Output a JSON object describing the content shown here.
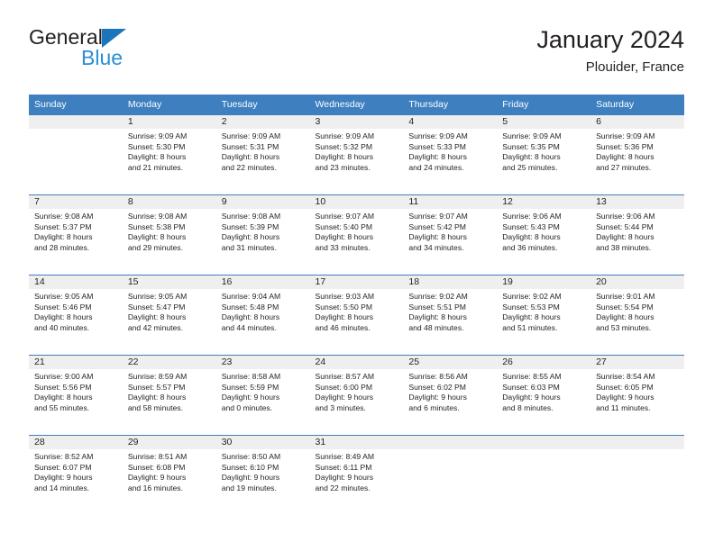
{
  "brand": {
    "name_part1": "General",
    "name_part2": "Blue",
    "triangle_icon": "triangle-logo-icon",
    "color_dark": "#231f20",
    "color_blue": "#2a8fd4"
  },
  "header": {
    "title": "January 2024",
    "subtitle": "Plouider, France"
  },
  "theme": {
    "header_blue": "#3d7fbf",
    "daynum_band": "#efefef",
    "text": "#231f20"
  },
  "calendar": {
    "weekday_headers": [
      "Sunday",
      "Monday",
      "Tuesday",
      "Wednesday",
      "Thursday",
      "Friday",
      "Saturday"
    ],
    "weeks": [
      [
        {
          "day": "",
          "empty": true,
          "sunrise": "",
          "sunset": "",
          "daylight_line1": "",
          "daylight_line2": ""
        },
        {
          "day": "1",
          "empty": false,
          "sunrise": "Sunrise: 9:09 AM",
          "sunset": "Sunset: 5:30 PM",
          "daylight_line1": "Daylight: 8 hours",
          "daylight_line2": "and 21 minutes."
        },
        {
          "day": "2",
          "empty": false,
          "sunrise": "Sunrise: 9:09 AM",
          "sunset": "Sunset: 5:31 PM",
          "daylight_line1": "Daylight: 8 hours",
          "daylight_line2": "and 22 minutes."
        },
        {
          "day": "3",
          "empty": false,
          "sunrise": "Sunrise: 9:09 AM",
          "sunset": "Sunset: 5:32 PM",
          "daylight_line1": "Daylight: 8 hours",
          "daylight_line2": "and 23 minutes."
        },
        {
          "day": "4",
          "empty": false,
          "sunrise": "Sunrise: 9:09 AM",
          "sunset": "Sunset: 5:33 PM",
          "daylight_line1": "Daylight: 8 hours",
          "daylight_line2": "and 24 minutes."
        },
        {
          "day": "5",
          "empty": false,
          "sunrise": "Sunrise: 9:09 AM",
          "sunset": "Sunset: 5:35 PM",
          "daylight_line1": "Daylight: 8 hours",
          "daylight_line2": "and 25 minutes."
        },
        {
          "day": "6",
          "empty": false,
          "sunrise": "Sunrise: 9:09 AM",
          "sunset": "Sunset: 5:36 PM",
          "daylight_line1": "Daylight: 8 hours",
          "daylight_line2": "and 27 minutes."
        }
      ],
      [
        {
          "day": "7",
          "empty": false,
          "sunrise": "Sunrise: 9:08 AM",
          "sunset": "Sunset: 5:37 PM",
          "daylight_line1": "Daylight: 8 hours",
          "daylight_line2": "and 28 minutes."
        },
        {
          "day": "8",
          "empty": false,
          "sunrise": "Sunrise: 9:08 AM",
          "sunset": "Sunset: 5:38 PM",
          "daylight_line1": "Daylight: 8 hours",
          "daylight_line2": "and 29 minutes."
        },
        {
          "day": "9",
          "empty": false,
          "sunrise": "Sunrise: 9:08 AM",
          "sunset": "Sunset: 5:39 PM",
          "daylight_line1": "Daylight: 8 hours",
          "daylight_line2": "and 31 minutes."
        },
        {
          "day": "10",
          "empty": false,
          "sunrise": "Sunrise: 9:07 AM",
          "sunset": "Sunset: 5:40 PM",
          "daylight_line1": "Daylight: 8 hours",
          "daylight_line2": "and 33 minutes."
        },
        {
          "day": "11",
          "empty": false,
          "sunrise": "Sunrise: 9:07 AM",
          "sunset": "Sunset: 5:42 PM",
          "daylight_line1": "Daylight: 8 hours",
          "daylight_line2": "and 34 minutes."
        },
        {
          "day": "12",
          "empty": false,
          "sunrise": "Sunrise: 9:06 AM",
          "sunset": "Sunset: 5:43 PM",
          "daylight_line1": "Daylight: 8 hours",
          "daylight_line2": "and 36 minutes."
        },
        {
          "day": "13",
          "empty": false,
          "sunrise": "Sunrise: 9:06 AM",
          "sunset": "Sunset: 5:44 PM",
          "daylight_line1": "Daylight: 8 hours",
          "daylight_line2": "and 38 minutes."
        }
      ],
      [
        {
          "day": "14",
          "empty": false,
          "sunrise": "Sunrise: 9:05 AM",
          "sunset": "Sunset: 5:46 PM",
          "daylight_line1": "Daylight: 8 hours",
          "daylight_line2": "and 40 minutes."
        },
        {
          "day": "15",
          "empty": false,
          "sunrise": "Sunrise: 9:05 AM",
          "sunset": "Sunset: 5:47 PM",
          "daylight_line1": "Daylight: 8 hours",
          "daylight_line2": "and 42 minutes."
        },
        {
          "day": "16",
          "empty": false,
          "sunrise": "Sunrise: 9:04 AM",
          "sunset": "Sunset: 5:48 PM",
          "daylight_line1": "Daylight: 8 hours",
          "daylight_line2": "and 44 minutes."
        },
        {
          "day": "17",
          "empty": false,
          "sunrise": "Sunrise: 9:03 AM",
          "sunset": "Sunset: 5:50 PM",
          "daylight_line1": "Daylight: 8 hours",
          "daylight_line2": "and 46 minutes."
        },
        {
          "day": "18",
          "empty": false,
          "sunrise": "Sunrise: 9:02 AM",
          "sunset": "Sunset: 5:51 PM",
          "daylight_line1": "Daylight: 8 hours",
          "daylight_line2": "and 48 minutes."
        },
        {
          "day": "19",
          "empty": false,
          "sunrise": "Sunrise: 9:02 AM",
          "sunset": "Sunset: 5:53 PM",
          "daylight_line1": "Daylight: 8 hours",
          "daylight_line2": "and 51 minutes."
        },
        {
          "day": "20",
          "empty": false,
          "sunrise": "Sunrise: 9:01 AM",
          "sunset": "Sunset: 5:54 PM",
          "daylight_line1": "Daylight: 8 hours",
          "daylight_line2": "and 53 minutes."
        }
      ],
      [
        {
          "day": "21",
          "empty": false,
          "sunrise": "Sunrise: 9:00 AM",
          "sunset": "Sunset: 5:56 PM",
          "daylight_line1": "Daylight: 8 hours",
          "daylight_line2": "and 55 minutes."
        },
        {
          "day": "22",
          "empty": false,
          "sunrise": "Sunrise: 8:59 AM",
          "sunset": "Sunset: 5:57 PM",
          "daylight_line1": "Daylight: 8 hours",
          "daylight_line2": "and 58 minutes."
        },
        {
          "day": "23",
          "empty": false,
          "sunrise": "Sunrise: 8:58 AM",
          "sunset": "Sunset: 5:59 PM",
          "daylight_line1": "Daylight: 9 hours",
          "daylight_line2": "and 0 minutes."
        },
        {
          "day": "24",
          "empty": false,
          "sunrise": "Sunrise: 8:57 AM",
          "sunset": "Sunset: 6:00 PM",
          "daylight_line1": "Daylight: 9 hours",
          "daylight_line2": "and 3 minutes."
        },
        {
          "day": "25",
          "empty": false,
          "sunrise": "Sunrise: 8:56 AM",
          "sunset": "Sunset: 6:02 PM",
          "daylight_line1": "Daylight: 9 hours",
          "daylight_line2": "and 6 minutes."
        },
        {
          "day": "26",
          "empty": false,
          "sunrise": "Sunrise: 8:55 AM",
          "sunset": "Sunset: 6:03 PM",
          "daylight_line1": "Daylight: 9 hours",
          "daylight_line2": "and 8 minutes."
        },
        {
          "day": "27",
          "empty": false,
          "sunrise": "Sunrise: 8:54 AM",
          "sunset": "Sunset: 6:05 PM",
          "daylight_line1": "Daylight: 9 hours",
          "daylight_line2": "and 11 minutes."
        }
      ],
      [
        {
          "day": "28",
          "empty": false,
          "sunrise": "Sunrise: 8:52 AM",
          "sunset": "Sunset: 6:07 PM",
          "daylight_line1": "Daylight: 9 hours",
          "daylight_line2": "and 14 minutes."
        },
        {
          "day": "29",
          "empty": false,
          "sunrise": "Sunrise: 8:51 AM",
          "sunset": "Sunset: 6:08 PM",
          "daylight_line1": "Daylight: 9 hours",
          "daylight_line2": "and 16 minutes."
        },
        {
          "day": "30",
          "empty": false,
          "sunrise": "Sunrise: 8:50 AM",
          "sunset": "Sunset: 6:10 PM",
          "daylight_line1": "Daylight: 9 hours",
          "daylight_line2": "and 19 minutes."
        },
        {
          "day": "31",
          "empty": false,
          "sunrise": "Sunrise: 8:49 AM",
          "sunset": "Sunset: 6:11 PM",
          "daylight_line1": "Daylight: 9 hours",
          "daylight_line2": "and 22 minutes."
        },
        {
          "day": "",
          "empty": true,
          "sunrise": "",
          "sunset": "",
          "daylight_line1": "",
          "daylight_line2": ""
        },
        {
          "day": "",
          "empty": true,
          "sunrise": "",
          "sunset": "",
          "daylight_line1": "",
          "daylight_line2": ""
        },
        {
          "day": "",
          "empty": true,
          "sunrise": "",
          "sunset": "",
          "daylight_line1": "",
          "daylight_line2": ""
        }
      ]
    ]
  }
}
